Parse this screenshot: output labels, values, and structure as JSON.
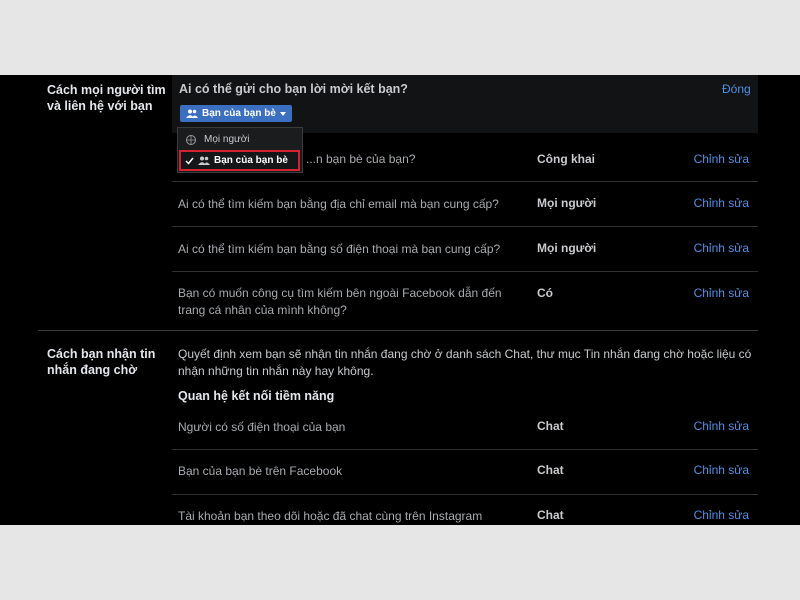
{
  "section1": {
    "title": "Cách mọi người tìm và liên hệ với bạn",
    "panel_question": "Ai có thể gửi cho bạn lời mời kết bạn?",
    "close_label": "Đóng",
    "button_label": "Bạn của bạn bè",
    "dropdown_options": [
      "Mọi người",
      "Bạn của bạn bè"
    ],
    "rows": [
      {
        "question": "...n bạn bè của bạn?",
        "value": "Công khai",
        "edit": "Chỉnh sửa"
      },
      {
        "question": "Ai có thể tìm kiếm bạn bằng địa chỉ email mà bạn cung cấp?",
        "value": "Mọi người",
        "edit": "Chỉnh sửa"
      },
      {
        "question": "Ai có thể tìm kiếm bạn bằng số điện thoại mà bạn cung cấp?",
        "value": "Mọi người",
        "edit": "Chỉnh sửa"
      },
      {
        "question": "Bạn có muốn công cụ tìm kiếm bên ngoài Facebook dẫn đến trang cá nhân của mình không?",
        "value": "Có",
        "edit": "Chỉnh sửa"
      }
    ]
  },
  "section2": {
    "title": "Cách bạn nhận tin nhắn đang chờ",
    "description": "Quyết định xem bạn sẽ nhận tin nhắn đang chờ ở danh sách Chat, thư mục Tin nhắn đang chờ hoặc liệu có nhận những tin nhắn này hay không.",
    "subheading": "Quan hệ kết nối tiềm năng",
    "rows": [
      {
        "question": "Người có số điện thoại của bạn",
        "value": "Chat",
        "edit": "Chỉnh sửa"
      },
      {
        "question": "Bạn của bạn bè trên Facebook",
        "value": "Chat",
        "edit": "Chỉnh sửa"
      },
      {
        "question": "Tài khoản bạn theo dõi hoặc đã chat cùng trên Instagram",
        "value": "Chat",
        "edit": "Chỉnh sửa"
      }
    ]
  }
}
